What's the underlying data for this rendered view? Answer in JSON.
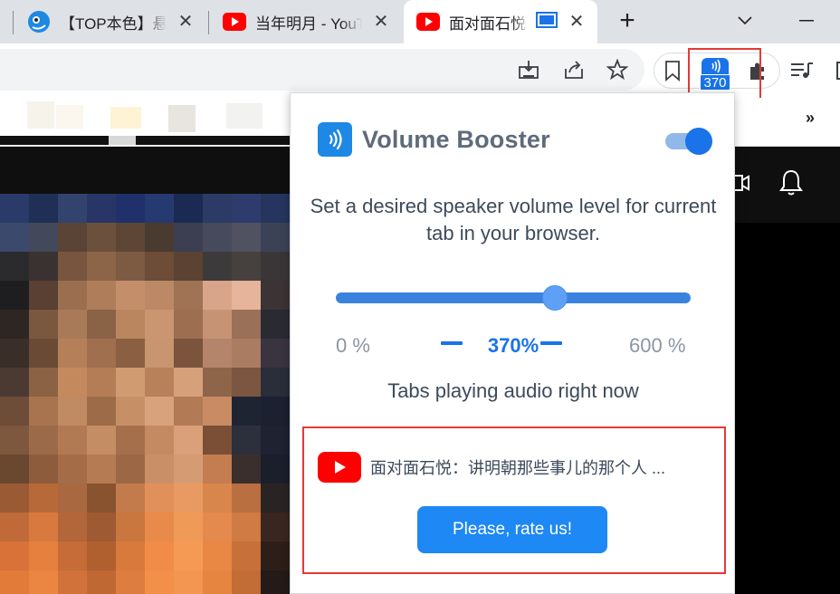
{
  "browser": {
    "tabs": [
      {
        "title": "【TOP本色】悬",
        "active": false
      },
      {
        "title": "当年明月 - YouTube",
        "active": false
      },
      {
        "title": "面对面石悦",
        "active": true
      }
    ],
    "new_tab_symbol": "+",
    "extension_badge": "370"
  },
  "popup": {
    "title": "Volume Booster",
    "enabled": true,
    "description": "Set a desired speaker volume level for current tab in your browser.",
    "volume": {
      "min_label": "0 %",
      "max_label": "600 %",
      "current_label": "370%",
      "current": 370,
      "min": 0,
      "max": 600
    },
    "tabs_heading": "Tabs playing audio right now",
    "audio_tabs": [
      {
        "title": "面对面石悦：讲明朝那些事儿的那个人 ..."
      }
    ],
    "rate_button": "Please, rate us!"
  },
  "colors": {
    "accent": "#1a73e8",
    "highlight_box": "#e53935",
    "youtube_red": "#ff0000"
  }
}
